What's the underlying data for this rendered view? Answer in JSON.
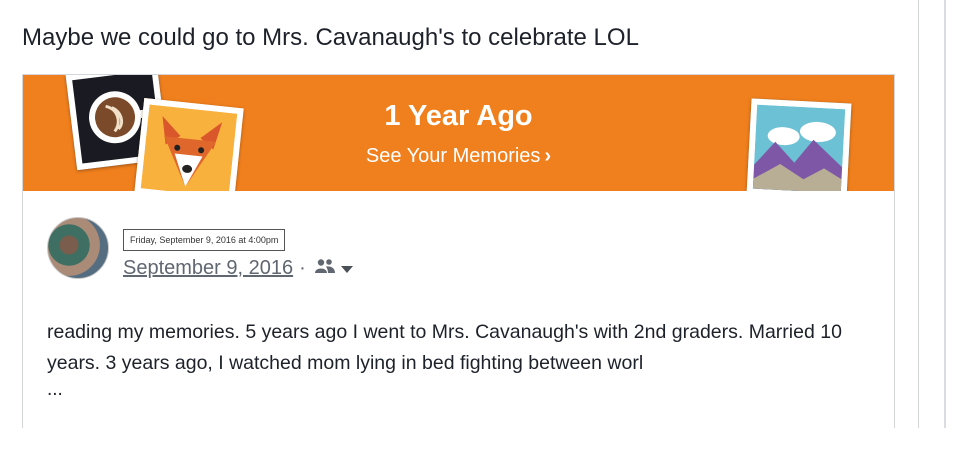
{
  "post": {
    "text": "Maybe we could go to Mrs. Cavanaugh's to celebrate LOL"
  },
  "memory_banner": {
    "title": "1 Year Ago",
    "link_label": "See Your Memories",
    "link_chevron": "›",
    "background_color": "#f07f1d",
    "images": [
      "coffee-photo",
      "dog-photo",
      "mountain-photo"
    ]
  },
  "shared_post": {
    "tooltip": "Friday, September 9, 2016 at 4:00pm",
    "date": "September 9, 2016",
    "separator": "·",
    "audience_icon": "friends-icon",
    "body": "reading my memories. 5 years ago I went to Mrs. Cavanaugh's with 2nd graders. Married 10 years. 3 years ago, I watched mom lying in bed fighting between worl",
    "ellipsis": "..."
  }
}
